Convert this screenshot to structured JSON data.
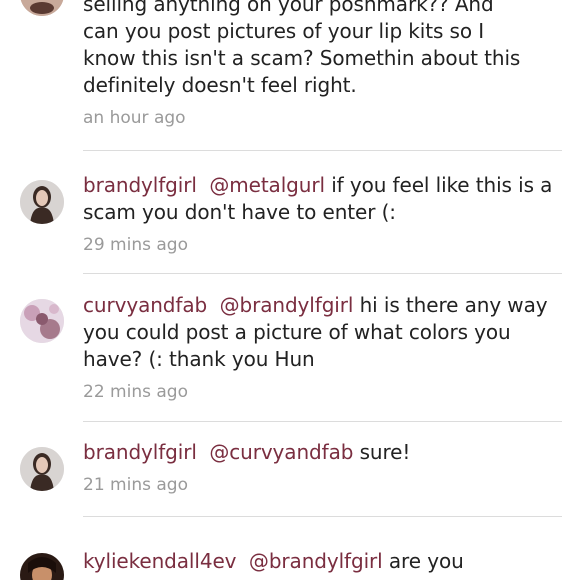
{
  "comments": [
    {
      "continued_text_lines": [
        "selling anything on your poshmark?? And",
        "can you post pictures of your lip kits so I",
        "know this isn't a scam? Somethin about this",
        "definitely doesn't feel right."
      ],
      "time": "an hour ago"
    },
    {
      "username": "brandylfgirl",
      "mention": "@metalgurl",
      "text": "if you feel like this is a scam you don't have to enter (:",
      "time": "29 mins ago"
    },
    {
      "username": "curvyandfab",
      "mention": "@brandylfgirl",
      "text": "hi is there any way you could post a picture of what colors you have? (: thank you Hun",
      "time": "22 mins ago"
    },
    {
      "username": "brandylfgirl",
      "mention": "@curvyandfab",
      "text": "sure!",
      "time": "21 mins ago"
    },
    {
      "username": "kyliekendall4ev",
      "mention": "@brandylfgirl",
      "text": "are you"
    }
  ]
}
